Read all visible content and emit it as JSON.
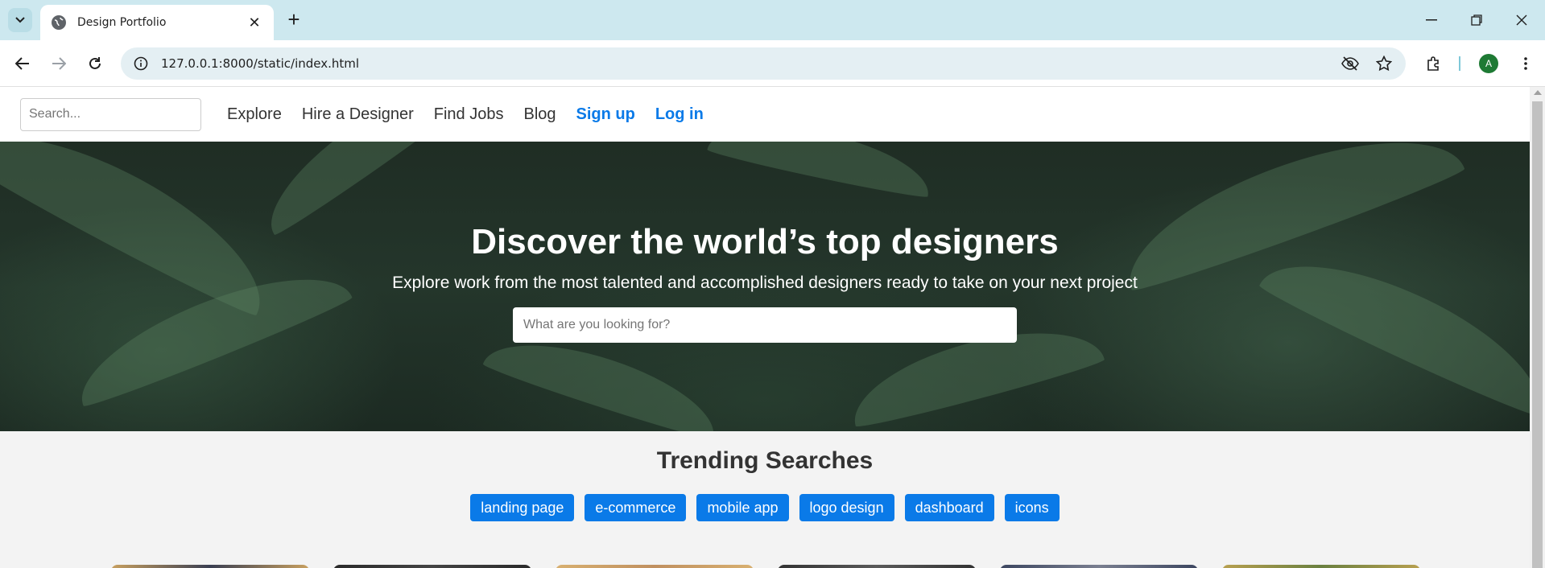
{
  "browser": {
    "tab_title": "Design Portfolio",
    "tab_close": "✕",
    "new_tab": "+",
    "url": "127.0.0.1:8000/static/index.html",
    "profile_initial": "A"
  },
  "nav": {
    "search_placeholder": "Search...",
    "links": [
      "Explore",
      "Hire a Designer",
      "Find Jobs",
      "Blog"
    ],
    "signup": "Sign up",
    "login": "Log in"
  },
  "hero": {
    "title": "Discover the world’s top designers",
    "subtitle": "Explore work from the most talented and accomplished designers ready to take on your next project",
    "search_placeholder": "What are you looking for?"
  },
  "trending": {
    "title": "Trending Searches",
    "tags": [
      "landing page",
      "e-commerce",
      "mobile app",
      "logo design",
      "dashboard",
      "icons"
    ]
  },
  "colors": {
    "accent": "#0a7ae8",
    "tab_strip": "#cde8ef",
    "page_bg": "#f3f3f3"
  }
}
